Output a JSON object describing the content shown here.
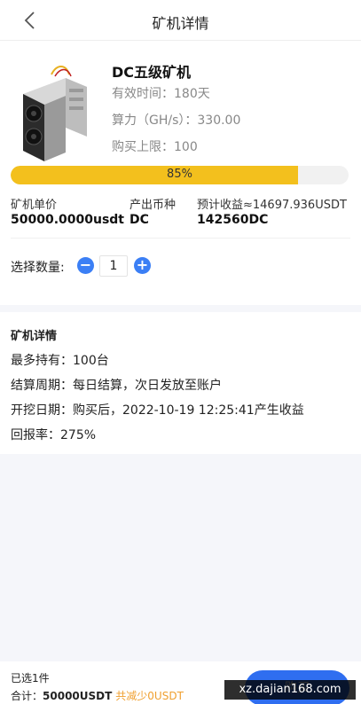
{
  "header": {
    "title": "矿机详情"
  },
  "miner": {
    "name": "DC五级矿机",
    "validity": "有效时间：180天",
    "hashrate": "算力（GH/s）：330.00",
    "purchase_limit": "购买上限：100"
  },
  "progress": {
    "value": 0.85,
    "label": "85%"
  },
  "stats": [
    {
      "label": "矿机单价",
      "value": "50000.0000usdt"
    },
    {
      "label": "产出币种",
      "value": "DC"
    },
    {
      "label": "预计收益≈14697.936USDT",
      "value": "142560DC"
    }
  ],
  "quantity": {
    "label": "选择数量:",
    "value": "1",
    "minus": "−",
    "plus": "+"
  },
  "details": {
    "title": "矿机详情",
    "rows": [
      "最多持有：100台",
      "结算周期：每日结算，次日发放至账户",
      "开挖日期：购买后，2022-10-19 12:25:41产生收益",
      "回报率：275%"
    ]
  },
  "footer": {
    "selected": "已选1件",
    "total_label": "合计：",
    "total_amount": "50000USDT",
    "saving": "共减少0USDT",
    "buy_label": "购买"
  },
  "watermark": "xz.dajian168.com",
  "colors": {
    "accent": "#2f6ef0",
    "progress": "#f3c01d",
    "stepper": "#3b7ff5",
    "saving": "#f0a030"
  }
}
